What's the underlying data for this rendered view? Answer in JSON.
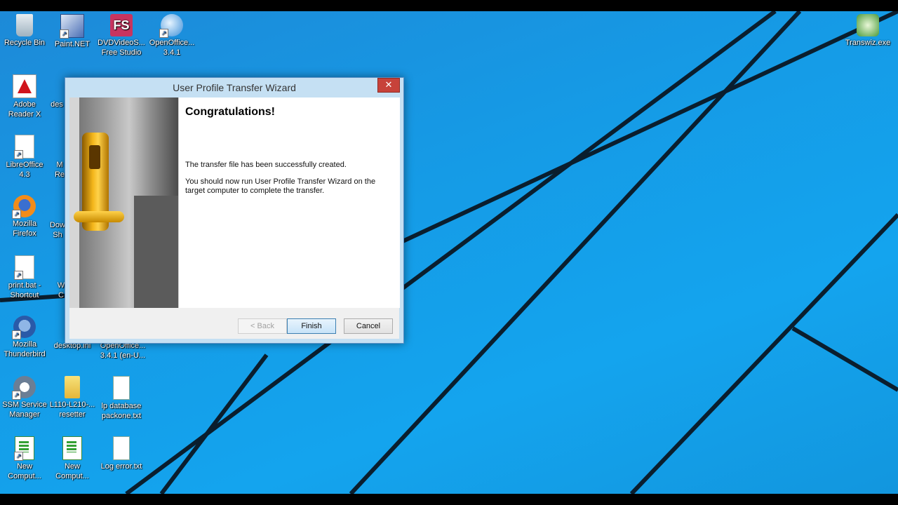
{
  "desktop": {
    "icons": [
      {
        "label": "Recycle Bin"
      },
      {
        "label": "Paint.NET"
      },
      {
        "label": "DVDVideoS...\nFree Studio"
      },
      {
        "label": "OpenOffice...\n3.4.1"
      },
      {
        "label": "Adobe\nReader X"
      },
      {
        "label": "des"
      },
      {
        "label": "LibreOffice\n4.3"
      },
      {
        "label": "M\nRe"
      },
      {
        "label": "Mozilla\nFirefox"
      },
      {
        "label": "Dow\nSh"
      },
      {
        "label": "print.bat -\nShortcut"
      },
      {
        "label": "W\nC"
      },
      {
        "label": "Mozilla\nThunderbird"
      },
      {
        "label": "desktop.ini"
      },
      {
        "label": "OpenOffice...\n3.4.1 (en-U..."
      },
      {
        "label": "SSM Service\nManager"
      },
      {
        "label": "L110-L210-...\nresetter"
      },
      {
        "label": "lp database\npackone.txt"
      },
      {
        "label": "New\nComput..."
      },
      {
        "label": "New\nComput..."
      },
      {
        "label": "Log error.txt"
      },
      {
        "label": "Transwiz.exe"
      }
    ]
  },
  "dialog": {
    "title": "User Profile Transfer Wizard",
    "close_label": "✕",
    "heading": "Congratulations!",
    "message1": "The transfer file has been successfully created.",
    "message2": "You should now run User Profile Transfer Wizard on the target computer to complete the transfer.",
    "back_label": "< Back",
    "finish_label": "Finish",
    "cancel_label": "Cancel"
  }
}
